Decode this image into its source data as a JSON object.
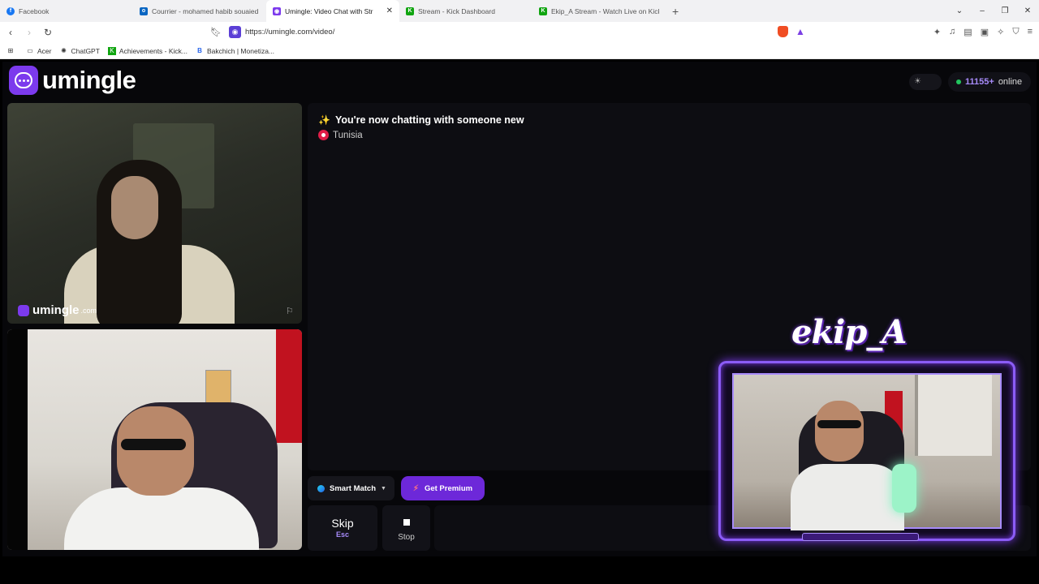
{
  "browser": {
    "tabs": [
      {
        "title": "Facebook",
        "icon": "facebook-icon",
        "color": "#1877f2",
        "glyph": "f"
      },
      {
        "title": "Courrier - mohamed habib souaied -",
        "icon": "outlook-icon",
        "color": "#0a66c2",
        "glyph": "o"
      },
      {
        "title": "Umingle: Video Chat with Str",
        "icon": "umingle-icon",
        "color": "#7c3aed",
        "glyph": "◉"
      },
      {
        "title": "Stream - Kick Dashboard",
        "icon": "kick-icon",
        "color": "#11a511",
        "glyph": "K"
      },
      {
        "title": "Ekip_A Stream - Watch Live on Kick",
        "icon": "kick-icon",
        "color": "#11a511",
        "glyph": "K"
      }
    ],
    "url": "https://umingle.com/video/",
    "bookmarks": [
      {
        "label": "Acer",
        "icon": "folder-icon"
      },
      {
        "label": "ChatGPT",
        "icon": "chatgpt-icon"
      },
      {
        "label": "Achievements - Kick...",
        "icon": "kick-icon"
      },
      {
        "label": "Bakchich | Monetiza...",
        "icon": "bakchich-icon"
      }
    ]
  },
  "header": {
    "logo_text": "umingle",
    "online_count": "11155+",
    "online_label": "online"
  },
  "video": {
    "watermark": "umingle",
    "watermark_suffix": ".com"
  },
  "chat": {
    "status_message": "You're now chatting with someone new",
    "country": "Tunisia"
  },
  "controls": {
    "smart_match": "Smart Match",
    "get_premium": "Get Premium",
    "skip": "Skip",
    "skip_key": "Esc",
    "stop": "Stop",
    "message_placeholder": ""
  },
  "overlay": {
    "streamer_name": "ekip_A"
  },
  "colors": {
    "accent": "#7c3aed",
    "online": "#22c55e",
    "background": "#07070a"
  }
}
